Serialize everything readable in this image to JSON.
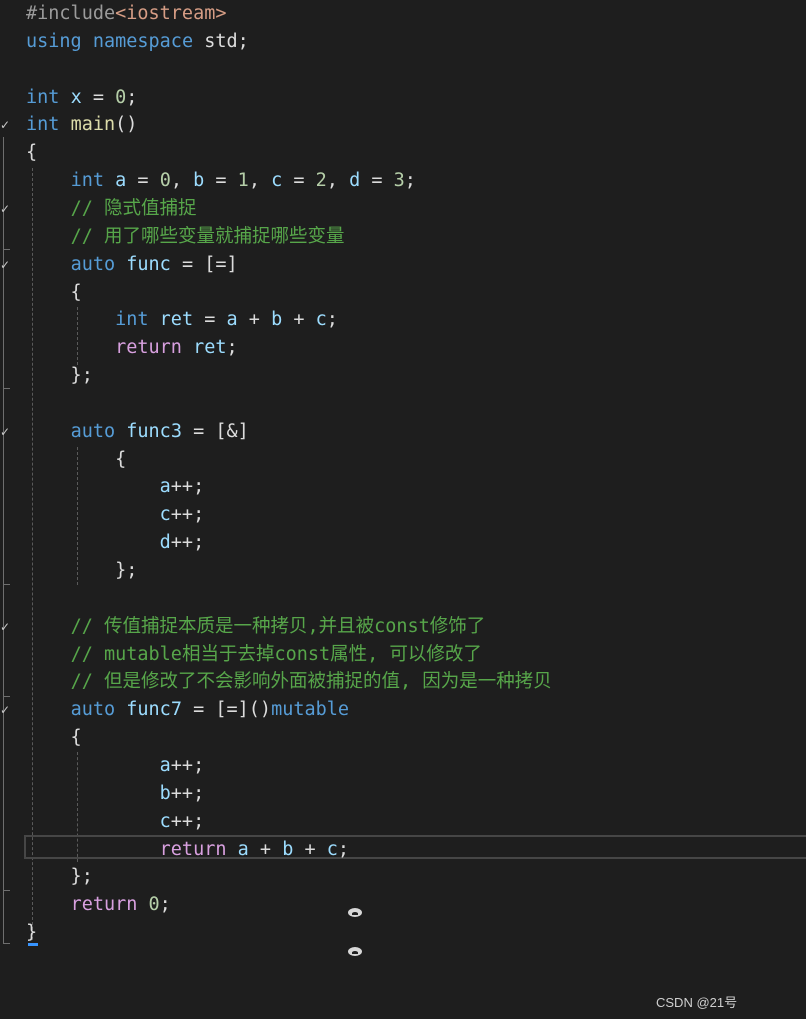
{
  "editor": {
    "lines": [
      [
        {
          "t": "#include",
          "c": "pp"
        },
        {
          "t": "<iostream>",
          "c": "inc"
        }
      ],
      [
        {
          "t": "using",
          "c": "kw"
        },
        {
          "t": " ",
          "c": "p"
        },
        {
          "t": "namespace",
          "c": "kw"
        },
        {
          "t": " std;",
          "c": "p"
        }
      ],
      [],
      [
        {
          "t": "int",
          "c": "kw"
        },
        {
          "t": " ",
          "c": "p"
        },
        {
          "t": "x",
          "c": "var"
        },
        {
          "t": " = ",
          "c": "p"
        },
        {
          "t": "0",
          "c": "num"
        },
        {
          "t": ";",
          "c": "p"
        }
      ],
      [
        {
          "t": "int",
          "c": "kw"
        },
        {
          "t": " ",
          "c": "p"
        },
        {
          "t": "main",
          "c": "fn"
        },
        {
          "t": "()",
          "c": "p"
        }
      ],
      [
        {
          "t": "{",
          "c": "p"
        }
      ],
      [
        {
          "t": "    ",
          "c": "p"
        },
        {
          "t": "int",
          "c": "kw"
        },
        {
          "t": " ",
          "c": "p"
        },
        {
          "t": "a",
          "c": "var"
        },
        {
          "t": " = ",
          "c": "p"
        },
        {
          "t": "0",
          "c": "num"
        },
        {
          "t": ", ",
          "c": "p"
        },
        {
          "t": "b",
          "c": "var"
        },
        {
          "t": " = ",
          "c": "p"
        },
        {
          "t": "1",
          "c": "num"
        },
        {
          "t": ", ",
          "c": "p"
        },
        {
          "t": "c",
          "c": "var"
        },
        {
          "t": " = ",
          "c": "p"
        },
        {
          "t": "2",
          "c": "num"
        },
        {
          "t": ", ",
          "c": "p"
        },
        {
          "t": "d",
          "c": "var"
        },
        {
          "t": " = ",
          "c": "p"
        },
        {
          "t": "3",
          "c": "num"
        },
        {
          "t": ";",
          "c": "p"
        }
      ],
      [
        {
          "t": "    ",
          "c": "p"
        },
        {
          "t": "// 隐式值捕捉",
          "c": "com"
        }
      ],
      [
        {
          "t": "    ",
          "c": "p"
        },
        {
          "t": "// 用了哪些变量就捕捉哪些变量",
          "c": "com"
        }
      ],
      [
        {
          "t": "    ",
          "c": "p"
        },
        {
          "t": "auto",
          "c": "kw"
        },
        {
          "t": " ",
          "c": "p"
        },
        {
          "t": "func",
          "c": "var"
        },
        {
          "t": " = [=]",
          "c": "p"
        }
      ],
      [
        {
          "t": "    {",
          "c": "p"
        }
      ],
      [
        {
          "t": "        ",
          "c": "p"
        },
        {
          "t": "int",
          "c": "kw"
        },
        {
          "t": " ",
          "c": "p"
        },
        {
          "t": "ret",
          "c": "var"
        },
        {
          "t": " = ",
          "c": "p"
        },
        {
          "t": "a",
          "c": "var"
        },
        {
          "t": " + ",
          "c": "p"
        },
        {
          "t": "b",
          "c": "var"
        },
        {
          "t": " + ",
          "c": "p"
        },
        {
          "t": "c",
          "c": "var"
        },
        {
          "t": ";",
          "c": "p"
        }
      ],
      [
        {
          "t": "        ",
          "c": "p"
        },
        {
          "t": "return",
          "c": "ctl"
        },
        {
          "t": " ",
          "c": "p"
        },
        {
          "t": "ret",
          "c": "var"
        },
        {
          "t": ";",
          "c": "p"
        }
      ],
      [
        {
          "t": "    };",
          "c": "p"
        }
      ],
      [],
      [
        {
          "t": "    ",
          "c": "p"
        },
        {
          "t": "auto",
          "c": "kw"
        },
        {
          "t": " ",
          "c": "p"
        },
        {
          "t": "func3",
          "c": "var"
        },
        {
          "t": " = [&]",
          "c": "p"
        }
      ],
      [
        {
          "t": "        {",
          "c": "p"
        }
      ],
      [
        {
          "t": "            ",
          "c": "p"
        },
        {
          "t": "a",
          "c": "var"
        },
        {
          "t": "++;",
          "c": "p"
        }
      ],
      [
        {
          "t": "            ",
          "c": "p"
        },
        {
          "t": "c",
          "c": "var"
        },
        {
          "t": "++;",
          "c": "p"
        }
      ],
      [
        {
          "t": "            ",
          "c": "p"
        },
        {
          "t": "d",
          "c": "var"
        },
        {
          "t": "++;",
          "c": "p"
        }
      ],
      [
        {
          "t": "        };",
          "c": "p"
        }
      ],
      [],
      [
        {
          "t": "    ",
          "c": "p"
        },
        {
          "t": "// 传值捕捉本质是一种拷贝,并且被const修饰了",
          "c": "com"
        }
      ],
      [
        {
          "t": "    ",
          "c": "p"
        },
        {
          "t": "// mutable相当于去掉const属性, 可以修改了",
          "c": "com"
        }
      ],
      [
        {
          "t": "    ",
          "c": "p"
        },
        {
          "t": "// 但是修改了不会影响外面被捕捉的值, 因为是一种拷贝",
          "c": "com"
        }
      ],
      [
        {
          "t": "    ",
          "c": "p"
        },
        {
          "t": "auto",
          "c": "kw"
        },
        {
          "t": " ",
          "c": "p"
        },
        {
          "t": "func7",
          "c": "var"
        },
        {
          "t": " = [=]()",
          "c": "p"
        },
        {
          "t": "mutable",
          "c": "kw"
        }
      ],
      [
        {
          "t": "    {",
          "c": "p"
        }
      ],
      [
        {
          "t": "            ",
          "c": "p"
        },
        {
          "t": "a",
          "c": "var"
        },
        {
          "t": "++;",
          "c": "p"
        }
      ],
      [
        {
          "t": "            ",
          "c": "p"
        },
        {
          "t": "b",
          "c": "var"
        },
        {
          "t": "++;",
          "c": "p"
        }
      ],
      [
        {
          "t": "            ",
          "c": "p"
        },
        {
          "t": "c",
          "c": "var"
        },
        {
          "t": "++;",
          "c": "p"
        }
      ],
      [
        {
          "t": "            ",
          "c": "p"
        },
        {
          "t": "return",
          "c": "ctl"
        },
        {
          "t": " ",
          "c": "p"
        },
        {
          "t": "a",
          "c": "var"
        },
        {
          "t": " + ",
          "c": "p"
        },
        {
          "t": "b",
          "c": "var"
        },
        {
          "t": " + ",
          "c": "p"
        },
        {
          "t": "c",
          "c": "var"
        },
        {
          "t": ";",
          "c": "p"
        }
      ],
      [
        {
          "t": "    };",
          "c": "p"
        }
      ],
      [
        {
          "t": "    ",
          "c": "p"
        },
        {
          "t": "return",
          "c": "ctl"
        },
        {
          "t": " ",
          "c": "p"
        },
        {
          "t": "0",
          "c": "num"
        },
        {
          "t": ";",
          "c": "p"
        }
      ],
      [
        {
          "t": "}",
          "c": "p"
        }
      ]
    ],
    "fold_marker_lines": [
      4,
      7,
      9,
      15,
      22,
      25
    ],
    "current_line": 30
  },
  "watermark": "CSDN @21号"
}
